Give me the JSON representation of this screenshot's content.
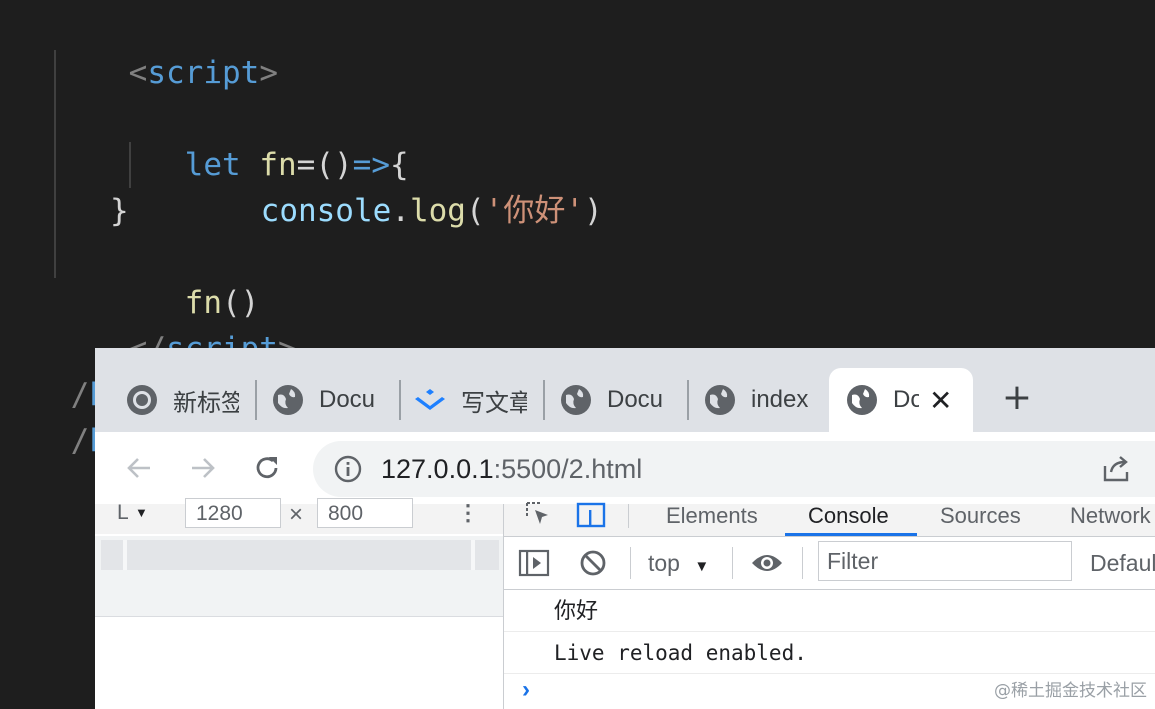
{
  "editor": {
    "line_script_open": {
      "lt": "<",
      "tag": "script",
      "gt": ">"
    },
    "line_let": {
      "kw": "let",
      "name": "fn",
      "eq": "=",
      "parens": "()",
      "arrow": "=>",
      "brace": "{"
    },
    "line_log": {
      "obj": "console",
      "dot": ".",
      "method": "log",
      "open": "(",
      "str": "'你好'",
      "close": ")"
    },
    "line_close_brace": "}",
    "line_call": {
      "name": "fn",
      "parens": "()"
    },
    "line_script_close": {
      "lt": "</",
      "tag": "script",
      "gt": ">"
    },
    "line_body_close": {
      "lt": "/",
      "tag": "body",
      "gt": ">"
    },
    "line_html_close": {
      "lt": "/",
      "tag": "html"
    }
  },
  "browser": {
    "tabs": [
      {
        "label": "新标签",
        "icon": "chrome-icon"
      },
      {
        "label": "Docu",
        "icon": "globe-icon"
      },
      {
        "label": "写文章",
        "icon": "juejin-icon"
      },
      {
        "label": "Docu",
        "icon": "globe-icon"
      },
      {
        "label": "index",
        "icon": "globe-icon"
      },
      {
        "label": "Do",
        "icon": "globe-icon",
        "active": true
      }
    ],
    "new_tab": "+",
    "close_tab": "✕",
    "url_host": "127.0.0.1",
    "url_rest": ":5500/2.html"
  },
  "device_toolbar": {
    "mode": "L",
    "width": "1280",
    "times": "×",
    "height": "800"
  },
  "devtools": {
    "tabs": [
      "Elements",
      "Console",
      "Sources",
      "Network"
    ],
    "active_tab": "Console",
    "context": "top",
    "filter_placeholder": "Filter",
    "levels": "Defaul",
    "messages": [
      "你好",
      "Live reload enabled."
    ]
  },
  "watermark": "@稀土掘金技术社区",
  "colors": {
    "editor_bg": "#1e1e1e",
    "keyword": "#569cd6",
    "function": "#dcdcaa",
    "variable": "#9cdcfe",
    "string": "#ce9178",
    "accent": "#1a73e8"
  }
}
